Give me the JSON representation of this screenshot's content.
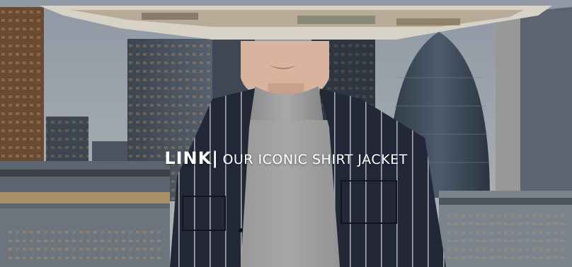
{
  "banner": {
    "brand": "LINK|",
    "tagline": "OUR ICONIC SHIRT JACKET"
  },
  "colors": {
    "sky": "#9aa2ad",
    "jacket": "#232838",
    "pinstripe": "#c9c9cf",
    "turtleneck": "#9b9b9b",
    "text": "#ffffff"
  }
}
